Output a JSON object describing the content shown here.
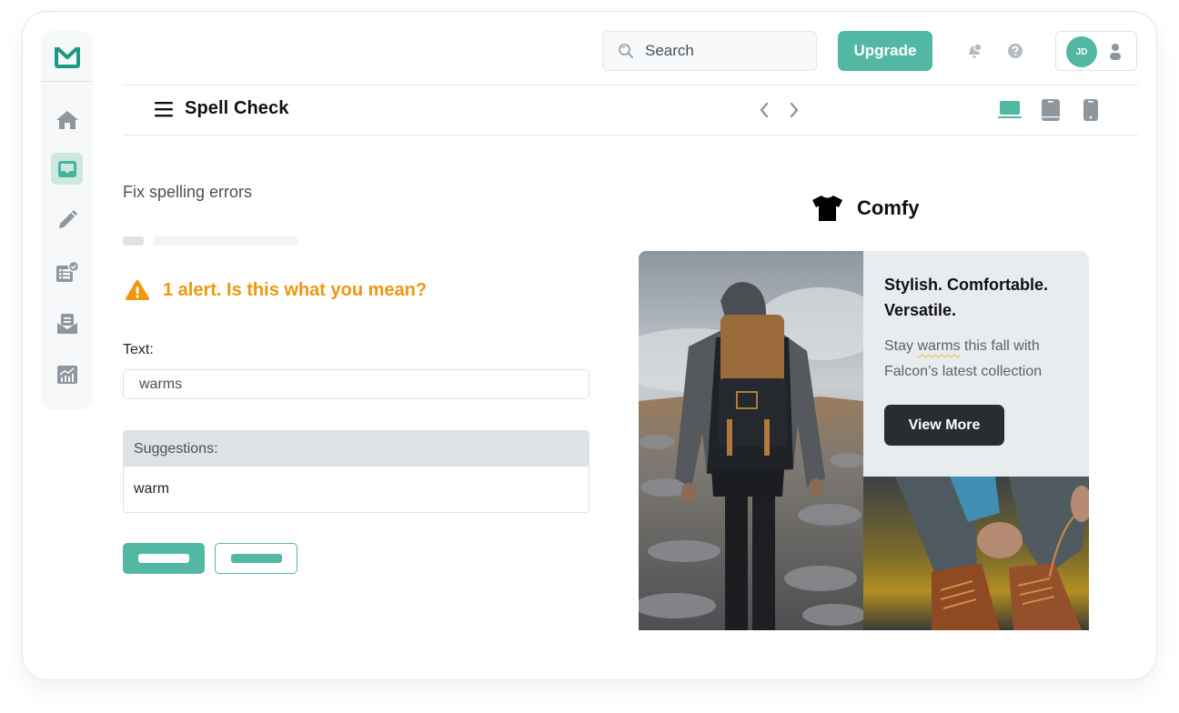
{
  "app": {
    "brand_color": "#52b8a4",
    "warning_color": "#f0960e"
  },
  "sidebar": {
    "logo": "mail-check-icon",
    "items": [
      {
        "name": "home",
        "icon": "home-icon",
        "active": false
      },
      {
        "name": "inbox",
        "icon": "inbox-icon",
        "active": true
      },
      {
        "name": "edit",
        "icon": "pencil-icon",
        "active": false
      },
      {
        "name": "tasks",
        "icon": "checklist-icon",
        "active": false
      },
      {
        "name": "mail",
        "icon": "mail-open-icon",
        "active": false
      },
      {
        "name": "analytics",
        "icon": "chart-icon",
        "active": false
      }
    ]
  },
  "topbar": {
    "search_placeholder": "Search",
    "upgrade_label": "Upgrade",
    "avatar_initials": "JD"
  },
  "subheader": {
    "title": "Spell Check",
    "devices": [
      {
        "name": "desktop",
        "active": true
      },
      {
        "name": "tablet",
        "active": false
      },
      {
        "name": "mobile",
        "active": false
      }
    ]
  },
  "checker": {
    "section_title": "Fix spelling errors",
    "alert_text": "1 alert. Is this what you mean?",
    "text_label": "Text:",
    "text_value": "warms",
    "suggestions_label": "Suggestions:",
    "suggestions": [
      "warm"
    ]
  },
  "preview": {
    "brand_name": "Comfy",
    "headline": "Stylish. Comfortable. Versatile.",
    "body_before": "Stay ",
    "body_misspelled": "warms",
    "body_after": " this fall with Falcon’s latest collection",
    "cta_label": "View More",
    "hero_image": "hiker with backpack on rocky mountain",
    "secondary_image": "person lacing brown leather boots"
  }
}
